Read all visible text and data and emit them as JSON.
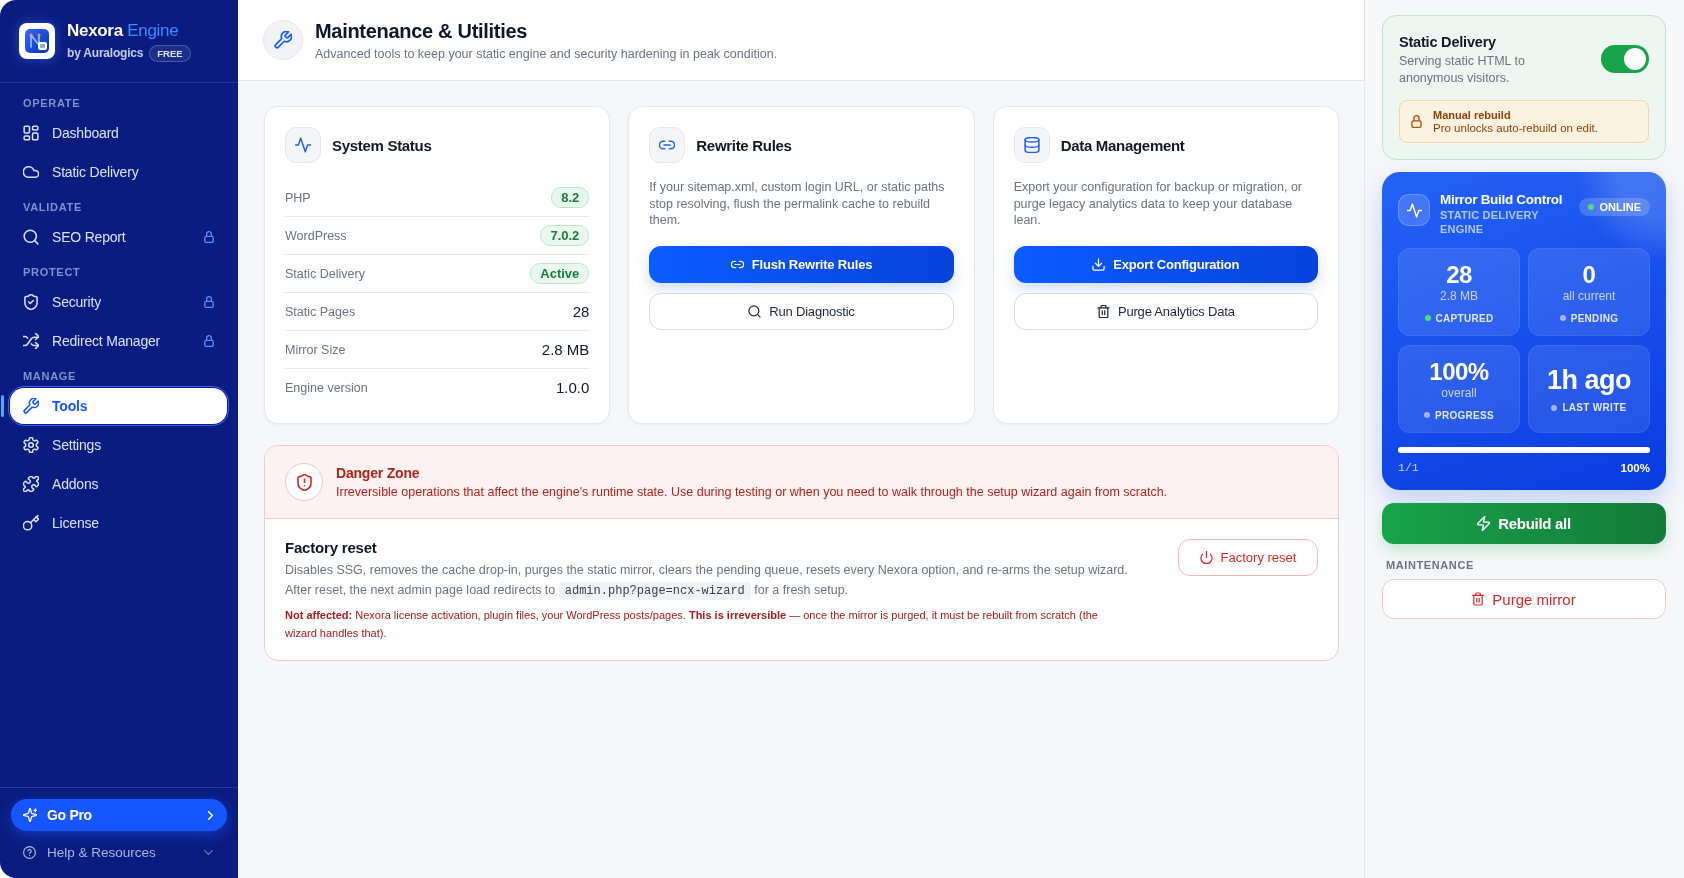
{
  "sidebar": {
    "brand": {
      "name": "Nexora",
      "accent": "Engine",
      "byline": "by Auralogics",
      "badge": "FREE"
    },
    "sections": [
      {
        "label": "OPERATE",
        "items": [
          {
            "label": "Dashboard",
            "selected": false,
            "locked": false
          },
          {
            "label": "Static Delivery",
            "selected": false,
            "locked": false
          }
        ]
      },
      {
        "label": "VALIDATE",
        "items": [
          {
            "label": "SEO Report",
            "selected": false,
            "locked": true
          }
        ]
      },
      {
        "label": "PROTECT",
        "items": [
          {
            "label": "Security",
            "selected": false,
            "locked": true
          },
          {
            "label": "Redirect Manager",
            "selected": false,
            "locked": true
          }
        ]
      },
      {
        "label": "MANAGE",
        "items": [
          {
            "label": "Tools",
            "selected": true,
            "locked": false
          },
          {
            "label": "Settings",
            "selected": false,
            "locked": false
          },
          {
            "label": "Addons",
            "selected": false,
            "locked": false
          },
          {
            "label": "License",
            "selected": false,
            "locked": false
          }
        ]
      }
    ],
    "go_pro": "Go Pro",
    "help": {
      "label": "Help & Resources",
      "expanded": false
    }
  },
  "header": {
    "title": "Maintenance & Utilities",
    "subtitle": "Advanced tools to keep your static engine and security hardening in peak condition."
  },
  "system_status": {
    "title": "System Status",
    "rows": [
      {
        "label": "PHP",
        "value": "8.2",
        "kind": "badge"
      },
      {
        "label": "WordPress",
        "value": "7.0.2",
        "kind": "badge"
      },
      {
        "label": "Static Delivery",
        "value": "Active",
        "kind": "badge"
      },
      {
        "label": "Static Pages",
        "value": "28",
        "kind": "plain"
      },
      {
        "label": "Mirror Size",
        "value": "2.8 MB",
        "kind": "plain"
      },
      {
        "label": "Engine version",
        "value": "1.0.0",
        "kind": "plain"
      }
    ]
  },
  "tool_cards": [
    {
      "title": "Rewrite Rules",
      "description": "If your sitemap.xml, custom login URL, or static paths stop resolving, flush the permalink cache to rebuild them.",
      "buttons": [
        {
          "label": "Flush Rewrite Rules",
          "kind": "primary"
        },
        {
          "label": "Run Diagnostic",
          "kind": "secondary"
        }
      ]
    },
    {
      "title": "Data Management",
      "description": "Export your configuration for backup or migration, or purge legacy analytics data to keep your database lean.",
      "buttons": [
        {
          "label": "Export Configuration",
          "kind": "primary"
        },
        {
          "label": "Purge Analytics Data",
          "kind": "secondary"
        }
      ]
    }
  ],
  "danger_zone": {
    "title": "Danger Zone",
    "description": "Irreversible operations that affect the engine's runtime state. Use during testing or when you need to walk through the setup wizard again from scratch.",
    "action": {
      "title": "Factory reset",
      "description": "Disables SSG, removes the cache drop-in, purges the static mirror, clears the pending queue, resets every Nexora option, and re-arms the setup wizard.",
      "redirect_note": {
        "before": "After reset, the next admin page load redirects to",
        "code": "admin.php?page=ncx-wizard",
        "after": "for a fresh setup."
      },
      "warning": "**Not affected:** Nexora license activation, plugin files, your WordPress posts/pages. **This is irreversible** — once the mirror is purged, it must be rebuilt from scratch (the wizard handles that).",
      "button": "Factory reset"
    }
  },
  "static_delivery": {
    "title": "Static Delivery",
    "description": "Serving static HTML to anonymous visitors.",
    "on": true,
    "notice": {
      "title": "Manual rebuild",
      "text": "Pro unlocks auto-rebuild on edit."
    }
  },
  "mirror_build": {
    "title": "Mirror Build Control",
    "subtitle": "STATIC DELIVERY ENGINE",
    "status": "ONLINE",
    "stats": [
      {
        "value": "28",
        "detail": "2.8 MB",
        "label": "CAPTURED",
        "color": "#4ade80"
      },
      {
        "value": "0",
        "detail": "all current",
        "label": "PENDING",
        "color": "#a5b4fc"
      },
      {
        "value": "100%",
        "detail": "overall",
        "label": "PROGRESS",
        "color": "#a5b4fc"
      },
      {
        "value": "1h ago",
        "label": "LAST WRITE",
        "color": "#a5b4fc"
      }
    ],
    "progress": {
      "level": 1,
      "count": "1/1",
      "percent": "100%"
    }
  },
  "rebuild_button": "Rebuild all",
  "maintenance": {
    "label": "MAINTENANCE",
    "button": "Purge mirror"
  }
}
